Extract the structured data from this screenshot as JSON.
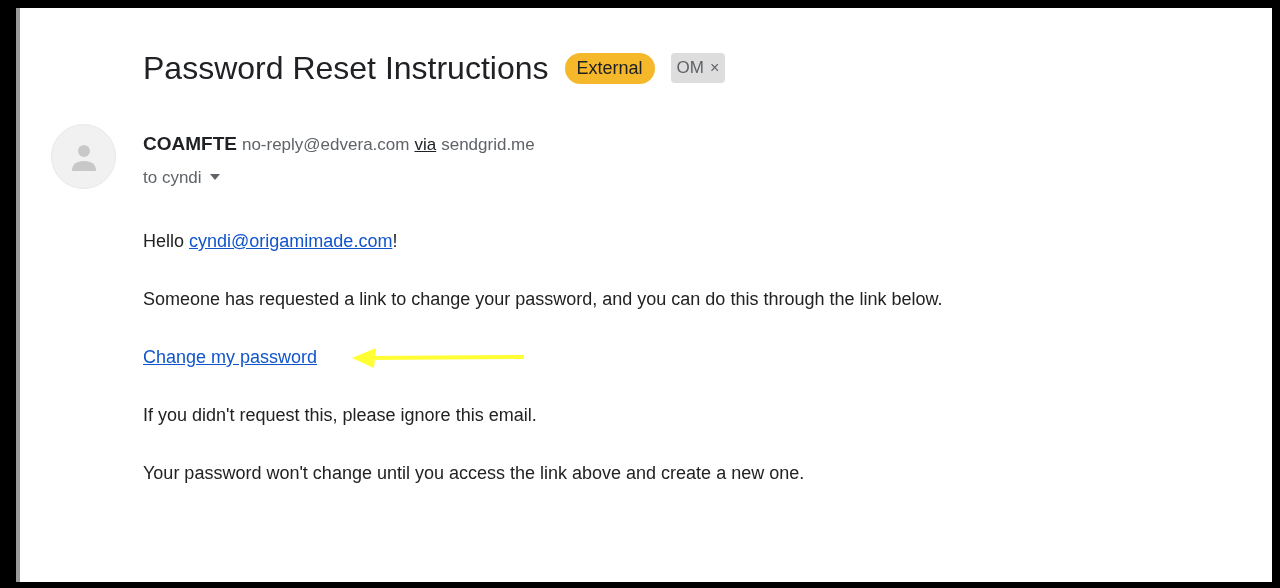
{
  "subject": "Password Reset Instructions",
  "labels": [
    {
      "kind": "external",
      "text": "External"
    },
    {
      "kind": "tag",
      "text": "OM",
      "remove": "×"
    }
  ],
  "sender": {
    "name": "COAMFTE",
    "email": "no-reply@edvera.com",
    "via": "via",
    "domain": "sendgrid.me",
    "recipients": "to cyndi"
  },
  "body": {
    "greeting": {
      "prefix": "Hello",
      "link": "cyndi@origamimade.com",
      "suffix": "!"
    },
    "intro": "Someone has requested a link to change your password, and you can do this through the link below.",
    "action_link": "Change my password",
    "notes": [
      "If you didn't request this, please ignore this email.",
      "Your password won't change until you access the link above and create a new one."
    ]
  }
}
